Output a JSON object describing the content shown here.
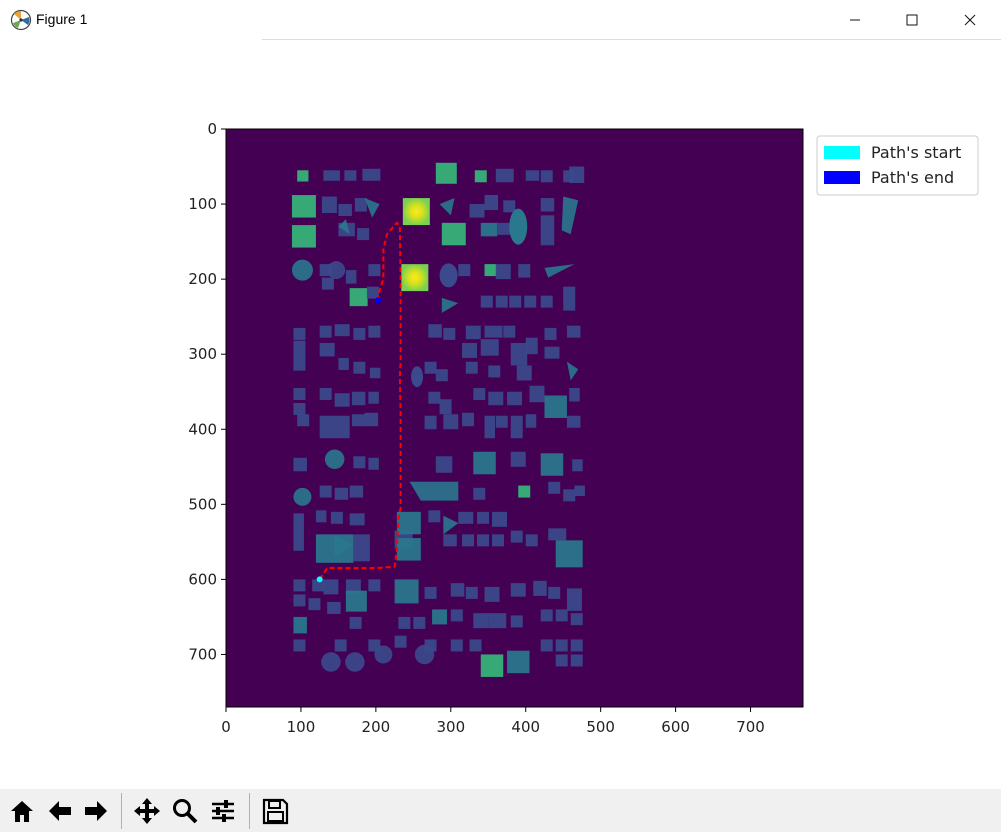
{
  "window": {
    "title": "Figure 1",
    "minimize": "—",
    "maximize": "☐",
    "close": "✕"
  },
  "figure": {
    "xticks": [
      "0",
      "100",
      "200",
      "300",
      "400",
      "500",
      "600",
      "700"
    ],
    "yticks": [
      "0",
      "100",
      "200",
      "300",
      "400",
      "500",
      "600",
      "700"
    ],
    "colors": {
      "background": "#440154",
      "path": "#ff0000",
      "start": "#00ffff",
      "end": "#0000ff",
      "shape_dim": "#3b4a8c",
      "shape_mid": "#2a788e",
      "shape_bright": "#35b779",
      "peak": "#d8e219"
    },
    "legend": [
      {
        "label": "Path's start",
        "color": "#00ffff"
      },
      {
        "label": "Path's end",
        "color": "#0000ff"
      }
    ]
  },
  "chart_data": {
    "type": "heatmap",
    "xlim": [
      0,
      770
    ],
    "ylim": [
      770,
      0
    ],
    "grid": false,
    "legend_placement": "upper-right-outside",
    "path": [
      [
        125,
        600
      ],
      [
        135,
        585
      ],
      [
        200,
        585
      ],
      [
        225,
        583
      ],
      [
        228,
        560
      ],
      [
        230,
        520
      ],
      [
        233,
        505
      ],
      [
        233,
        380
      ],
      [
        232,
        330
      ],
      [
        233,
        310
      ],
      [
        233,
        200
      ],
      [
        232,
        130
      ],
      [
        228,
        125
      ],
      [
        215,
        140
      ],
      [
        210,
        160
      ],
      [
        210,
        200
      ],
      [
        205,
        215
      ],
      [
        203,
        225
      ]
    ],
    "start_point": [
      125,
      600
    ],
    "end_point": [
      203,
      228
    ],
    "peaks": [
      [
        254,
        110
      ],
      [
        252,
        198
      ]
    ]
  },
  "toolbar": {
    "home": "home",
    "back": "back",
    "forward": "forward",
    "pan": "pan",
    "zoom": "zoom",
    "configure": "configure",
    "save": "save"
  }
}
